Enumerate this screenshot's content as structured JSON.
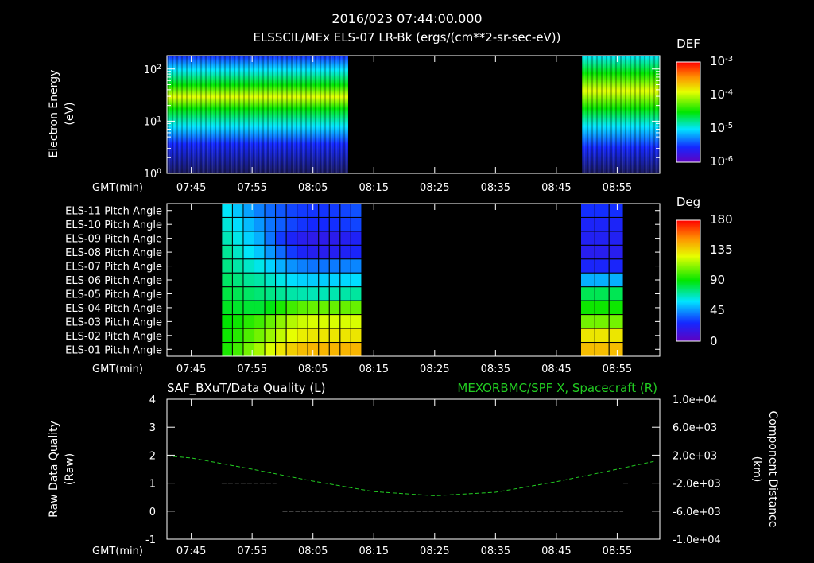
{
  "header": {
    "timestamp": "2016/023 07:44:00.000",
    "title": "ELSSCIL/MEx ELS-07 LR-Bk  (ergs/(cm**2-sr-sec-eV))"
  },
  "time_axis": {
    "label": "GMT(min)",
    "ticks": [
      "07:45",
      "07:55",
      "08:05",
      "08:15",
      "08:25",
      "08:35",
      "08:45",
      "08:55"
    ]
  },
  "colors": {
    "background": "#000000",
    "axes": "#ffffff",
    "component_line": "#22cc22",
    "quality_line": "#ffffff"
  },
  "chart_data": [
    {
      "type": "heatmap",
      "ylabel": "Electron Energy",
      "yunit": "(eV)",
      "yscale": "log",
      "yticks": [
        "10^0",
        "10^1",
        "10^2"
      ],
      "ylim_ev": [
        1,
        180
      ],
      "colorbar": {
        "label": "DEF",
        "ticks": [
          "10^-3",
          "10^-4",
          "10^-5",
          "10^-6"
        ],
        "scale": "log"
      },
      "data_intervals": [
        {
          "start": "07:45",
          "end": "08:12",
          "peak_energy_ev": [
            30,
            20,
            10
          ]
        },
        {
          "start": "08:49",
          "end": "09:01",
          "peak_energy_ev": [
            40
          ]
        }
      ],
      "gap": [
        "08:12",
        "08:49"
      ]
    },
    {
      "type": "heatmap",
      "rows": [
        "ELS-11 Pitch Angle",
        "ELS-10 Pitch Angle",
        "ELS-09 Pitch Angle",
        "ELS-08 Pitch Angle",
        "ELS-07 Pitch Angle",
        "ELS-06 Pitch Angle",
        "ELS-05 Pitch Angle",
        "ELS-04 Pitch Angle",
        "ELS-03 Pitch Angle",
        "ELS-02 Pitch Angle",
        "ELS-01 Pitch Angle"
      ],
      "colorbar": {
        "label": "Deg",
        "ticks": [
          "180",
          "135",
          "90",
          "45",
          "0"
        ]
      },
      "blocks": [
        {
          "start": "07:50",
          "end": "08:13",
          "columns": 13,
          "pitch_deg": [
            [
              60,
              54,
              48,
              42,
              38,
              35,
              32,
              30,
              29,
              29,
              30,
              32,
              34
            ],
            [
              64,
              58,
              52,
              46,
              40,
              36,
              32,
              29,
              27,
              27,
              28,
              30,
              32
            ],
            [
              68,
              62,
              56,
              50,
              40,
              30,
              24,
              20,
              18,
              18,
              19,
              21,
              23
            ],
            [
              72,
              66,
              60,
              54,
              46,
              38,
              30,
              24,
              21,
              20,
              21,
              23,
              25
            ],
            [
              74,
              70,
              66,
              62,
              56,
              50,
              45,
              42,
              40,
              40,
              41,
              42,
              43
            ],
            [
              78,
              75,
              72,
              70,
              66,
              62,
              58,
              56,
              55,
              55,
              56,
              57,
              58
            ],
            [
              82,
              80,
              78,
              76,
              74,
              72,
              70,
              69,
              68,
              68,
              69,
              70,
              71
            ],
            [
              86,
              85,
              84,
              84,
              88,
              94,
              100,
              104,
              106,
              106,
              106,
              106,
              106
            ],
            [
              90,
              92,
              96,
              100,
              106,
              112,
              118,
              122,
              124,
              124,
              124,
              124,
              124
            ],
            [
              92,
              96,
              102,
              108,
              114,
              120,
              126,
              130,
              132,
              132,
              132,
              132,
              132
            ],
            [
              94,
              100,
              108,
              116,
              124,
              132,
              138,
              142,
              144,
              144,
              144,
              144,
              144
            ]
          ]
        },
        {
          "start": "08:49",
          "end": "08:56",
          "columns": 3,
          "pitch_deg": [
            [
              28,
              28,
              28
            ],
            [
              24,
              24,
              24
            ],
            [
              22,
              22,
              22
            ],
            [
              20,
              20,
              20
            ],
            [
              25,
              25,
              25
            ],
            [
              50,
              50,
              50
            ],
            [
              80,
              80,
              80
            ],
            [
              92,
              92,
              92
            ],
            [
              108,
              108,
              108
            ],
            [
              132,
              132,
              132
            ],
            [
              142,
              142,
              142
            ]
          ]
        }
      ]
    },
    {
      "type": "line",
      "title_left": "SAF_BXuT/Data Quality (L)",
      "title_right": "MEXORBMC/SPF X, Spacecraft (R)",
      "ylabel_left": "Raw Data Quality",
      "ylabel_left_unit": "(Raw)",
      "ylim_left": [
        -1,
        4
      ],
      "yticks_left": [
        "-1",
        "0",
        "1",
        "2",
        "3",
        "4"
      ],
      "ylabel_right": "Component Distance",
      "ylabel_right_unit": "(km)",
      "ylim_right": [
        -10000,
        10000
      ],
      "yticks_right": [
        "1.0e+04",
        "6.0e+03",
        "2.0e+03",
        "-2.0e+03",
        "-6.0e+03",
        "-1.0e+04"
      ],
      "series": [
        {
          "name": "Data Quality",
          "axis": "left",
          "style": "dashed",
          "segments": [
            {
              "x": [
                "07:50",
                "07:59"
              ],
              "y": [
                1,
                1
              ]
            },
            {
              "x": [
                "08:00",
                "08:56"
              ],
              "y": [
                0,
                0
              ]
            },
            {
              "x": [
                "08:56",
                "08:57"
              ],
              "y": [
                1,
                1
              ]
            }
          ]
        },
        {
          "name": "Spacecraft X",
          "axis": "right",
          "style": "dashed",
          "x": [
            "07:45",
            "07:55",
            "08:05",
            "08:15",
            "08:25",
            "08:35",
            "08:45",
            "08:55",
            "09:01"
          ],
          "y": [
            1600,
            0,
            -1700,
            -3200,
            -3800,
            -3300,
            -1800,
            0,
            1100
          ]
        }
      ]
    }
  ]
}
